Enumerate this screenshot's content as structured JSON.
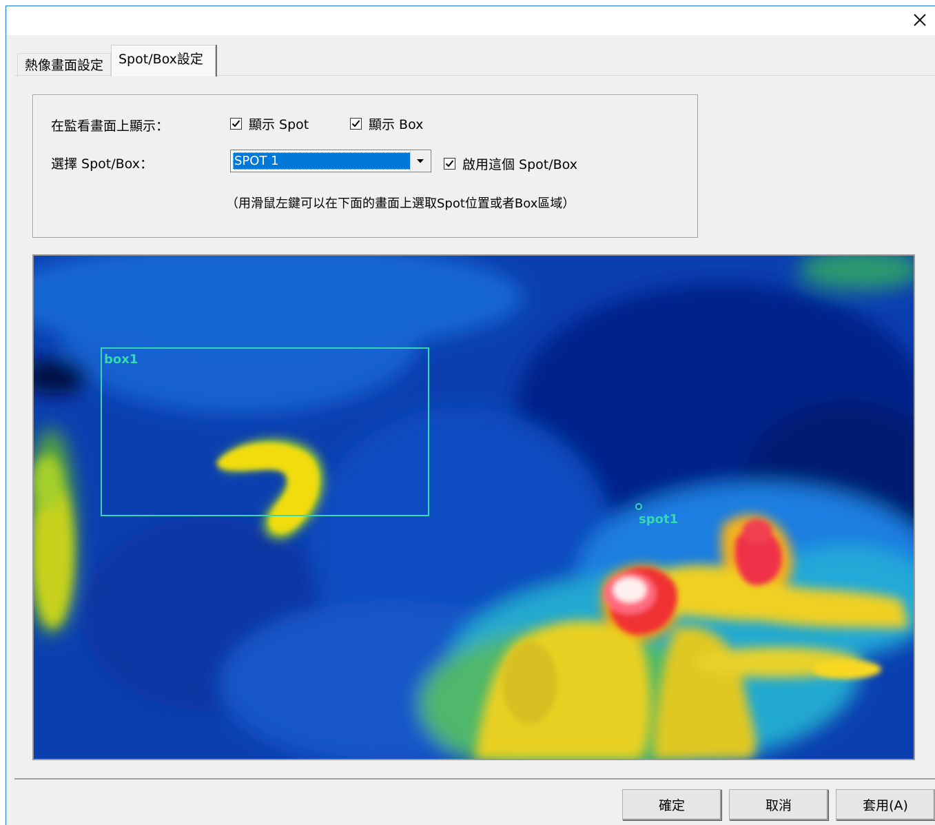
{
  "tabs": [
    {
      "label": "熱像畫面設定",
      "active": false
    },
    {
      "label": "Spot/Box設定",
      "active": true
    }
  ],
  "settings": {
    "show_on_monitor_label": "在監看畫面上顯示：",
    "show_spot": {
      "label": "顯示 Spot",
      "checked": true
    },
    "show_box": {
      "label": "顯示 Box",
      "checked": true
    },
    "select_label": "選擇 Spot/Box：",
    "select_value": "SPOT 1",
    "enable": {
      "label": "啟用這個 Spot/Box",
      "checked": true
    },
    "hint": "（用滑鼠左鍵可以在下面的畫面上選取Spot位置或者Box區域）"
  },
  "thermal_view": {
    "box_label": "box1",
    "spot_label": "spot1",
    "overlay_color": "#33d9b0"
  },
  "buttons": {
    "ok": "確定",
    "cancel": "取消",
    "apply": "套用(A)"
  },
  "icons": {
    "close": "close-icon",
    "check": "check-icon",
    "dropdown": "chevron-down-icon"
  }
}
